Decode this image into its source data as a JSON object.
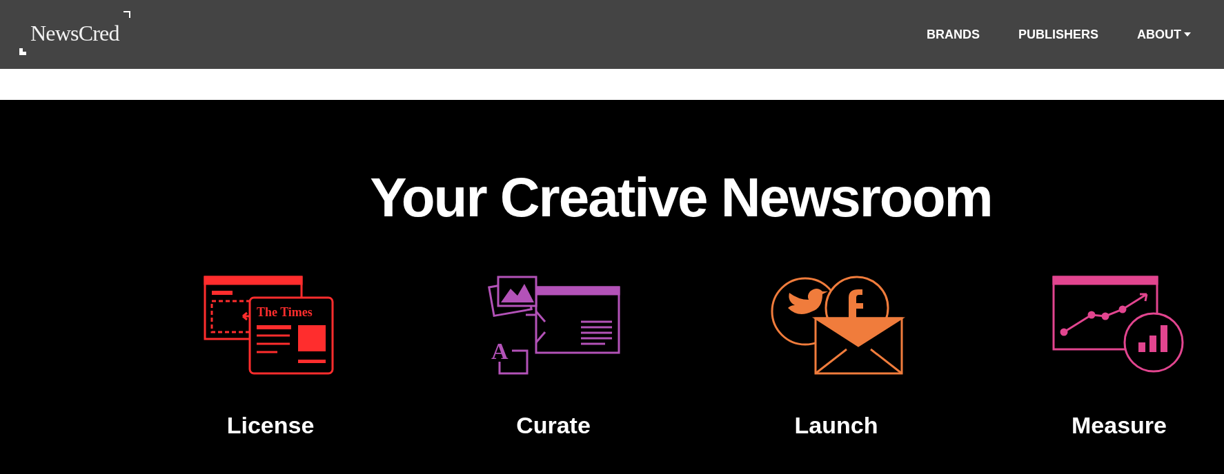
{
  "header": {
    "logo": "NewsCred",
    "nav": [
      {
        "label": "BRANDS",
        "dropdown": false
      },
      {
        "label": "PUBLISHERS",
        "dropdown": false
      },
      {
        "label": "ABOUT",
        "dropdown": true
      }
    ]
  },
  "hero": {
    "title": "Your Creative Newsroom",
    "features": [
      {
        "kind": "license",
        "label": "License",
        "color": "#ff2d2d",
        "icon_text": "The Times"
      },
      {
        "kind": "curate",
        "label": "Curate",
        "color": "#b352b8",
        "icon_text": "A"
      },
      {
        "kind": "launch",
        "label": "Launch",
        "color": "#f07c3c"
      },
      {
        "kind": "measure",
        "label": "Measure",
        "color": "#e2458f"
      }
    ]
  }
}
